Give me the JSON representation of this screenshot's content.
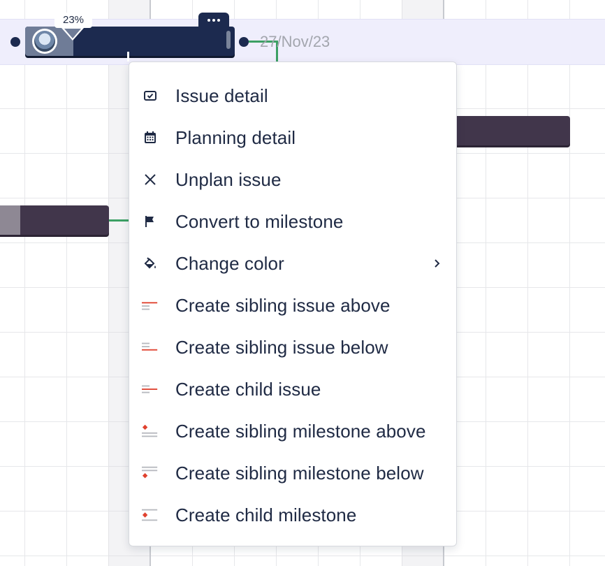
{
  "gantt": {
    "selected_task": {
      "progress_label": "23%",
      "progress_percent": 23,
      "due_date": "27/Nov/23"
    },
    "colors": {
      "task_bar": "#1c2a4f",
      "other_bar": "#41364b",
      "selected_row": "#efeefc",
      "dependency": "#3ca064",
      "accent_red": "#e0412e"
    }
  },
  "context_menu": {
    "items": [
      {
        "label": "Issue detail",
        "icon": "issue-detail-icon"
      },
      {
        "label": "Planning detail",
        "icon": "calendar-icon"
      },
      {
        "label": "Unplan issue",
        "icon": "close-icon"
      },
      {
        "label": "Convert to milestone",
        "icon": "flag-icon"
      },
      {
        "label": "Change color",
        "icon": "paint-bucket-icon",
        "has_submenu": true
      },
      {
        "label": "Create sibling issue above",
        "icon": "sibling-issue-above-icon"
      },
      {
        "label": "Create sibling issue below",
        "icon": "sibling-issue-below-icon"
      },
      {
        "label": "Create child issue",
        "icon": "child-issue-icon"
      },
      {
        "label": "Create sibling milestone above",
        "icon": "sibling-milestone-above-icon"
      },
      {
        "label": "Create sibling milestone below",
        "icon": "sibling-milestone-below-icon"
      },
      {
        "label": "Create child milestone",
        "icon": "child-milestone-icon"
      }
    ]
  }
}
